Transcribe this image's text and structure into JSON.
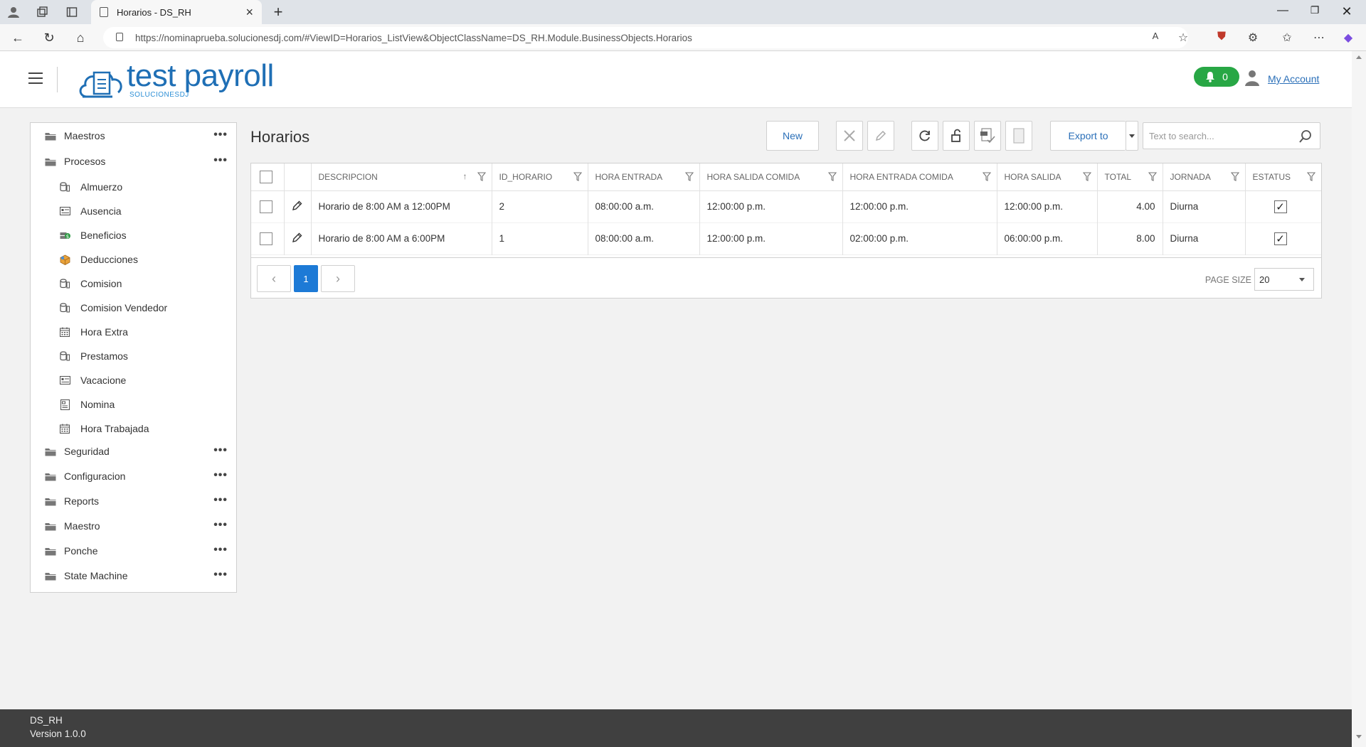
{
  "browser": {
    "tab_title": "Horarios - DS_RH",
    "url": "https://nominaprueba.solucionesdj.com/#ViewID=Horarios_ListView&ObjectClassName=DS_RH.Module.BusinessObjects.Horarios"
  },
  "header": {
    "brand": "test payroll",
    "brand_sub": "SOLUCIONESDJ",
    "notifications": "0",
    "account_label": "My Account"
  },
  "sidebar": {
    "groups_top": [
      {
        "label": "Maestros"
      },
      {
        "label": "Procesos"
      }
    ],
    "procesos_items": [
      {
        "label": "Almuerzo",
        "icon": "database-icon"
      },
      {
        "label": "Ausencia",
        "icon": "list-card-icon"
      },
      {
        "label": "Beneficios",
        "icon": "money-icon"
      },
      {
        "label": "Deducciones",
        "icon": "box-icon"
      },
      {
        "label": "Comision",
        "icon": "database-icon"
      },
      {
        "label": "Comision Vendedor",
        "icon": "database-icon"
      },
      {
        "label": "Hora Extra",
        "icon": "calendar-icon"
      },
      {
        "label": "Prestamos",
        "icon": "database-icon"
      },
      {
        "label": "Vacacione",
        "icon": "list-card-icon"
      },
      {
        "label": "Nomina",
        "icon": "document-icon"
      },
      {
        "label": "Hora Trabajada",
        "icon": "calendar-icon"
      }
    ],
    "groups_bottom": [
      {
        "label": "Seguridad"
      },
      {
        "label": "Configuracion"
      },
      {
        "label": "Reports"
      },
      {
        "label": "Maestro"
      },
      {
        "label": "Ponche"
      },
      {
        "label": "State Machine"
      }
    ]
  },
  "main": {
    "title": "Horarios",
    "toolbar": {
      "new_label": "New",
      "export_label": "Export to",
      "search_placeholder": "Text to search..."
    },
    "columns": [
      "DESCRIPCION",
      "ID_HORARIO",
      "HORA ENTRADA",
      "HORA SALIDA COMIDA",
      "HORA ENTRADA COMIDA",
      "HORA SALIDA",
      "TOTAL",
      "JORNADA",
      "ESTATUS"
    ],
    "rows": [
      {
        "descripcion": "Horario de 8:00 AM a 12:00PM",
        "id": "2",
        "entrada": "08:00:00 a.m.",
        "salida_comida": "12:00:00 p.m.",
        "entrada_comida": "12:00:00 p.m.",
        "salida": "12:00:00 p.m.",
        "total": "4.00",
        "jornada": "Diurna",
        "estatus": true
      },
      {
        "descripcion": "Horario de 8:00 AM a 6:00PM",
        "id": "1",
        "entrada": "08:00:00 a.m.",
        "salida_comida": "12:00:00 p.m.",
        "entrada_comida": "02:00:00 p.m.",
        "salida": "06:00:00 p.m.",
        "total": "8.00",
        "jornada": "Diurna",
        "estatus": true
      }
    ],
    "pager": {
      "current_page": "1",
      "page_size_label": "PAGE SIZE",
      "page_size": "20"
    }
  },
  "footer": {
    "app_name": "DS_RH",
    "version": "Version 1.0.0"
  },
  "colors": {
    "accent": "#1d7ad6",
    "brand": "#1f6fb5",
    "notif": "#28a745",
    "footer": "#404040"
  }
}
